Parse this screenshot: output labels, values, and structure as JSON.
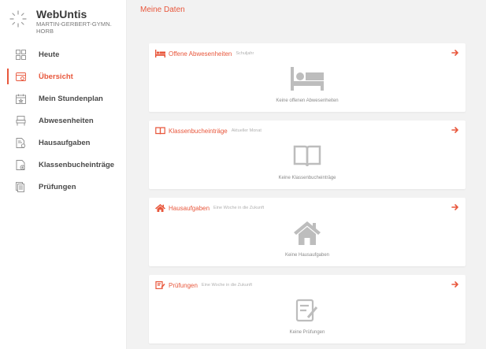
{
  "brand": {
    "name": "WebUntis",
    "school_line1": "MARTIN-GERBERT-GYMN.",
    "school_line2": "HORB"
  },
  "nav": [
    {
      "label": "Heute",
      "icon": "dashboard-icon",
      "active": false
    },
    {
      "label": "Übersicht",
      "icon": "overview-icon",
      "active": true
    },
    {
      "label": "Mein Stundenplan",
      "icon": "calendar-icon",
      "active": false
    },
    {
      "label": "Abwesenheiten",
      "icon": "bed-icon",
      "active": false
    },
    {
      "label": "Hausaufgaben",
      "icon": "homework-icon",
      "active": false
    },
    {
      "label": "Klassenbucheinträge",
      "icon": "classbook-icon",
      "active": false
    },
    {
      "label": "Prüfungen",
      "icon": "exams-icon",
      "active": false
    }
  ],
  "page": {
    "title": "Meine Daten"
  },
  "cards": [
    {
      "title": "Offene Abwesenheiten",
      "subtitle": "Schuljahr",
      "empty": "Keine offenen Abwesenheiten",
      "icon": "bed-icon"
    },
    {
      "title": "Klassenbucheinträge",
      "subtitle": "Aktueller Monat",
      "empty": "Keine Klassenbucheinträge",
      "icon": "book-icon"
    },
    {
      "title": "Hausaufgaben",
      "subtitle": "Eine Woche in die Zukunft",
      "empty": "Keine Hausaufgaben",
      "icon": "home-icon"
    },
    {
      "title": "Prüfungen",
      "subtitle": "Eine Woche in die Zukunft",
      "empty": "Keine Prüfungen",
      "icon": "exam-icon"
    }
  ],
  "colors": {
    "accent": "#e8573c",
    "icon_gray": "#bdbdbd",
    "background": "#f2f2f2"
  }
}
